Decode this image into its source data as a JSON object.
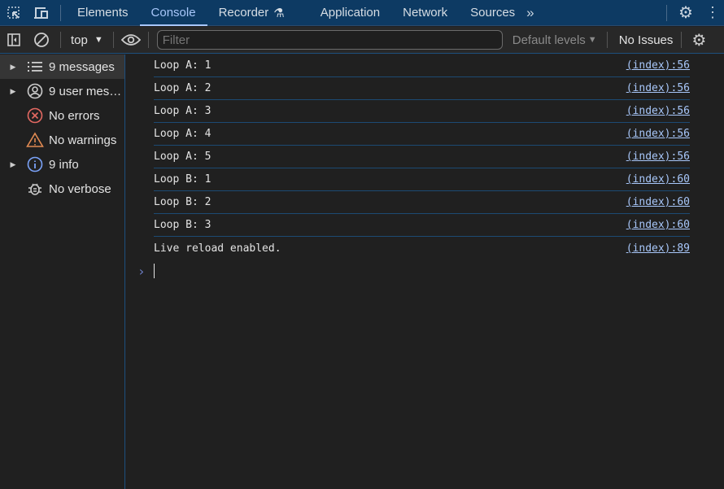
{
  "tabbar": {
    "tabs": [
      {
        "label": "Elements"
      },
      {
        "label": "Console",
        "active": true
      },
      {
        "label": "Recorder"
      },
      {
        "label": "Application"
      },
      {
        "label": "Network"
      },
      {
        "label": "Sources"
      }
    ]
  },
  "toolbar": {
    "context": "top",
    "filter_placeholder": "Filter",
    "levels": "Default levels",
    "issues": "No Issues"
  },
  "sidebar": {
    "items": [
      {
        "label": "9 messages",
        "icon": "list-icon"
      },
      {
        "label": "9 user mes…",
        "icon": "user-icon"
      },
      {
        "label": "No errors",
        "icon": "error-icon"
      },
      {
        "label": "No warnings",
        "icon": "warning-icon"
      },
      {
        "label": "9 info",
        "icon": "info-icon"
      },
      {
        "label": "No verbose",
        "icon": "bug-icon"
      }
    ]
  },
  "console": {
    "messages": [
      {
        "text": "Loop A: 1",
        "source": "(index):56"
      },
      {
        "text": "Loop A: 2",
        "source": "(index):56"
      },
      {
        "text": "Loop A: 3",
        "source": "(index):56"
      },
      {
        "text": "Loop A: 4",
        "source": "(index):56"
      },
      {
        "text": "Loop A: 5",
        "source": "(index):56"
      },
      {
        "text": "Loop B: 1",
        "source": "(index):60"
      },
      {
        "text": "Loop B: 2",
        "source": "(index):60"
      },
      {
        "text": "Loop B: 3",
        "source": "(index):60"
      },
      {
        "text": "Live reload enabled.",
        "source": "(index):89"
      }
    ]
  },
  "colors": {
    "accent": "#a8c7fa",
    "tabbar": "#0d3a63",
    "error": "#e46962",
    "warning": "#e08a52",
    "info": "#7aa2f7"
  }
}
